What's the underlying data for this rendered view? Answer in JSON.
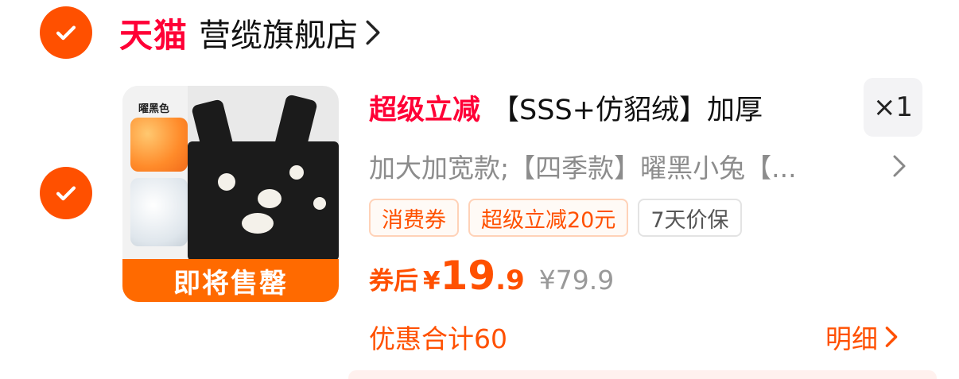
{
  "store": {
    "platform_logo": "天猫",
    "name": "营缆旗舰店",
    "selected": true
  },
  "item": {
    "selected": true,
    "thumbnail": {
      "color_label": "曜黑色",
      "banner": "即将售罄"
    },
    "promo_tag": "超级立减",
    "title": "【SSS+仿貂绒】加厚",
    "quantity": "×1",
    "sku": "加大加宽款;【四季款】曜黑小兔【...",
    "tags": [
      {
        "label": "消费券",
        "style": "orange"
      },
      {
        "label": "超级立减20元",
        "style": "orange"
      },
      {
        "label": "7天价保",
        "style": "grey"
      }
    ],
    "price": {
      "label": "券后",
      "currency": "¥",
      "integer": "19",
      "decimal": ".9",
      "original": "¥79.9"
    },
    "discount_total": "优惠合计60",
    "detail_link": "明细"
  },
  "colors": {
    "accent": "#ff5000",
    "tmall_red": "#ff0036",
    "muted_text": "#8c8c8c"
  },
  "icons": [
    "check-icon",
    "chevron-right-icon"
  ]
}
